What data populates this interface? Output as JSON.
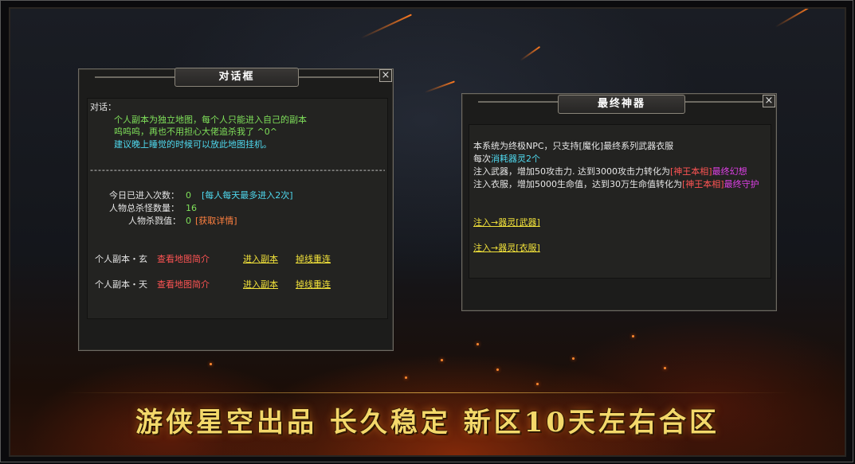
{
  "dialog": {
    "title": "对话框",
    "close": "×",
    "intro_label": "对话：",
    "intro_lines": [
      "个人副本为独立地图，每个人只能进入自己的副本",
      "呜呜呜，再也不用担心大佬追杀我了 ^0^"
    ],
    "tip": "建议晚上睡觉的时候可以放此地图挂机。",
    "divider": "------------------------------------------------------------------------------------------",
    "stats": {
      "entered_label": "今日已进入次数：",
      "entered_value": "0",
      "entered_note": "[每人每天最多进入2次]",
      "kills_label": "人物总杀怪数量：",
      "kills_value": "16",
      "kill_value_label": "人物杀戮值：",
      "kill_value": "0",
      "kill_value_link": "[获取详情]"
    },
    "dungeons": [
      {
        "name": "个人副本・玄",
        "view": "查看地图简介",
        "enter": "进入副本",
        "reconnect": "掉线重连"
      },
      {
        "name": "个人副本・天",
        "view": "查看地图简介",
        "enter": "进入副本",
        "reconnect": "掉线重连"
      }
    ]
  },
  "artifact": {
    "title": "最终神器",
    "close": "×",
    "desc_line1": "本系统为终极NPC，只支持[魔化]最终系列武器衣服",
    "cost_prefix": "每次",
    "cost_value": "消耗器灵2个",
    "weapon_line": "注入武器，增加50攻击力.   达到3000攻击力转化为",
    "weapon_tag": "[神王本相]",
    "weapon_result": "最终幻想",
    "armor_line": "注入衣服，增加5000生命值，达到30万生命值转化为",
    "armor_tag": "[神王本相]",
    "armor_result": "最终守护",
    "inject_weapon": "注入→器灵[武器]",
    "inject_armor": "注入→器灵[衣服]"
  },
  "banner": "游侠星空出品 长久稳定 新区10天左右合区"
}
